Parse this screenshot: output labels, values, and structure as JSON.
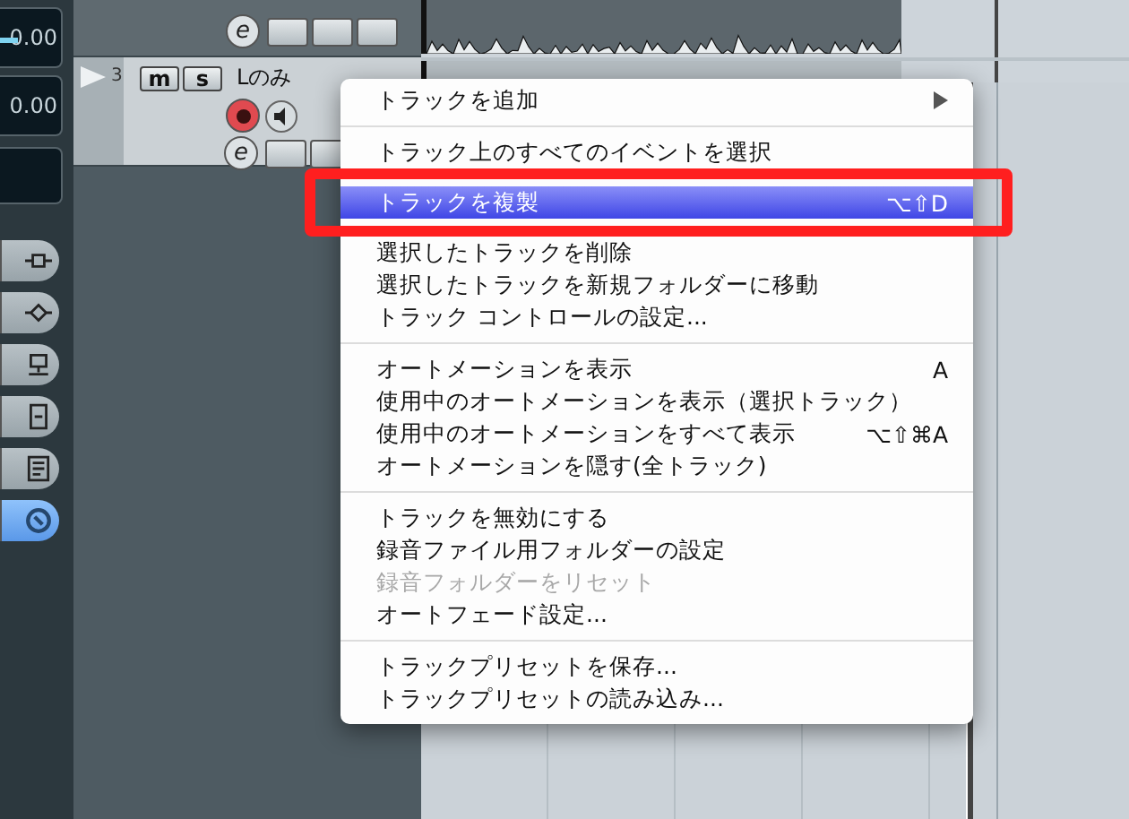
{
  "mixer_readouts": [
    "0.00",
    "0.00"
  ],
  "track_above": {
    "edit_label": "e"
  },
  "tracks": [
    {
      "number": "3",
      "edit_label": "e",
      "mute_label": "m",
      "solo_label": "s",
      "name": "Lのみ",
      "record_armed": true
    }
  ],
  "inspector_tabs": [
    {
      "selected": false
    },
    {
      "selected": false
    },
    {
      "selected": false
    },
    {
      "selected": false
    },
    {
      "selected": false
    },
    {
      "selected": true
    }
  ],
  "context_menu": {
    "items": [
      {
        "kind": "item",
        "label": "トラックを追加",
        "submenu": true,
        "disabled": false,
        "selected": false
      },
      {
        "kind": "separator"
      },
      {
        "kind": "item",
        "label": "トラック上のすべてのイベントを選択",
        "disabled": false,
        "selected": false
      },
      {
        "kind": "item",
        "label": "トラックを複製",
        "shortcut": "⌥⇧D",
        "disabled": false,
        "selected": true
      },
      {
        "kind": "item",
        "label": "選択したトラックを削除",
        "disabled": false,
        "selected": false
      },
      {
        "kind": "item",
        "label": "選択したトラックを新規フォルダーに移動",
        "disabled": false,
        "selected": false
      },
      {
        "kind": "item",
        "label": "トラック コントロールの設定...",
        "disabled": false,
        "selected": false
      },
      {
        "kind": "separator"
      },
      {
        "kind": "item",
        "label": "オートメーションを表示",
        "shortcut": "A",
        "disabled": false,
        "selected": false
      },
      {
        "kind": "item",
        "label": "使用中のオートメーションを表示（選択トラック）",
        "disabled": false,
        "selected": false
      },
      {
        "kind": "item",
        "label": "使用中のオートメーションをすべて表示",
        "shortcut": "⌥⇧⌘A",
        "disabled": false,
        "selected": false
      },
      {
        "kind": "item",
        "label": "オートメーションを隠す(全トラック)",
        "disabled": false,
        "selected": false
      },
      {
        "kind": "separator"
      },
      {
        "kind": "item",
        "label": "トラックを無効にする",
        "disabled": false,
        "selected": false
      },
      {
        "kind": "item",
        "label": "録音ファイル用フォルダーの設定",
        "disabled": false,
        "selected": false
      },
      {
        "kind": "item",
        "label": "録音フォルダーをリセット",
        "disabled": true,
        "selected": false
      },
      {
        "kind": "item",
        "label": "オートフェード設定...",
        "disabled": false,
        "selected": false
      },
      {
        "kind": "separator"
      },
      {
        "kind": "item",
        "label": "トラックプリセットを保存...",
        "disabled": false,
        "selected": false
      },
      {
        "kind": "item",
        "label": "トラックプリセットの読み込み...",
        "disabled": false,
        "selected": false
      }
    ]
  }
}
